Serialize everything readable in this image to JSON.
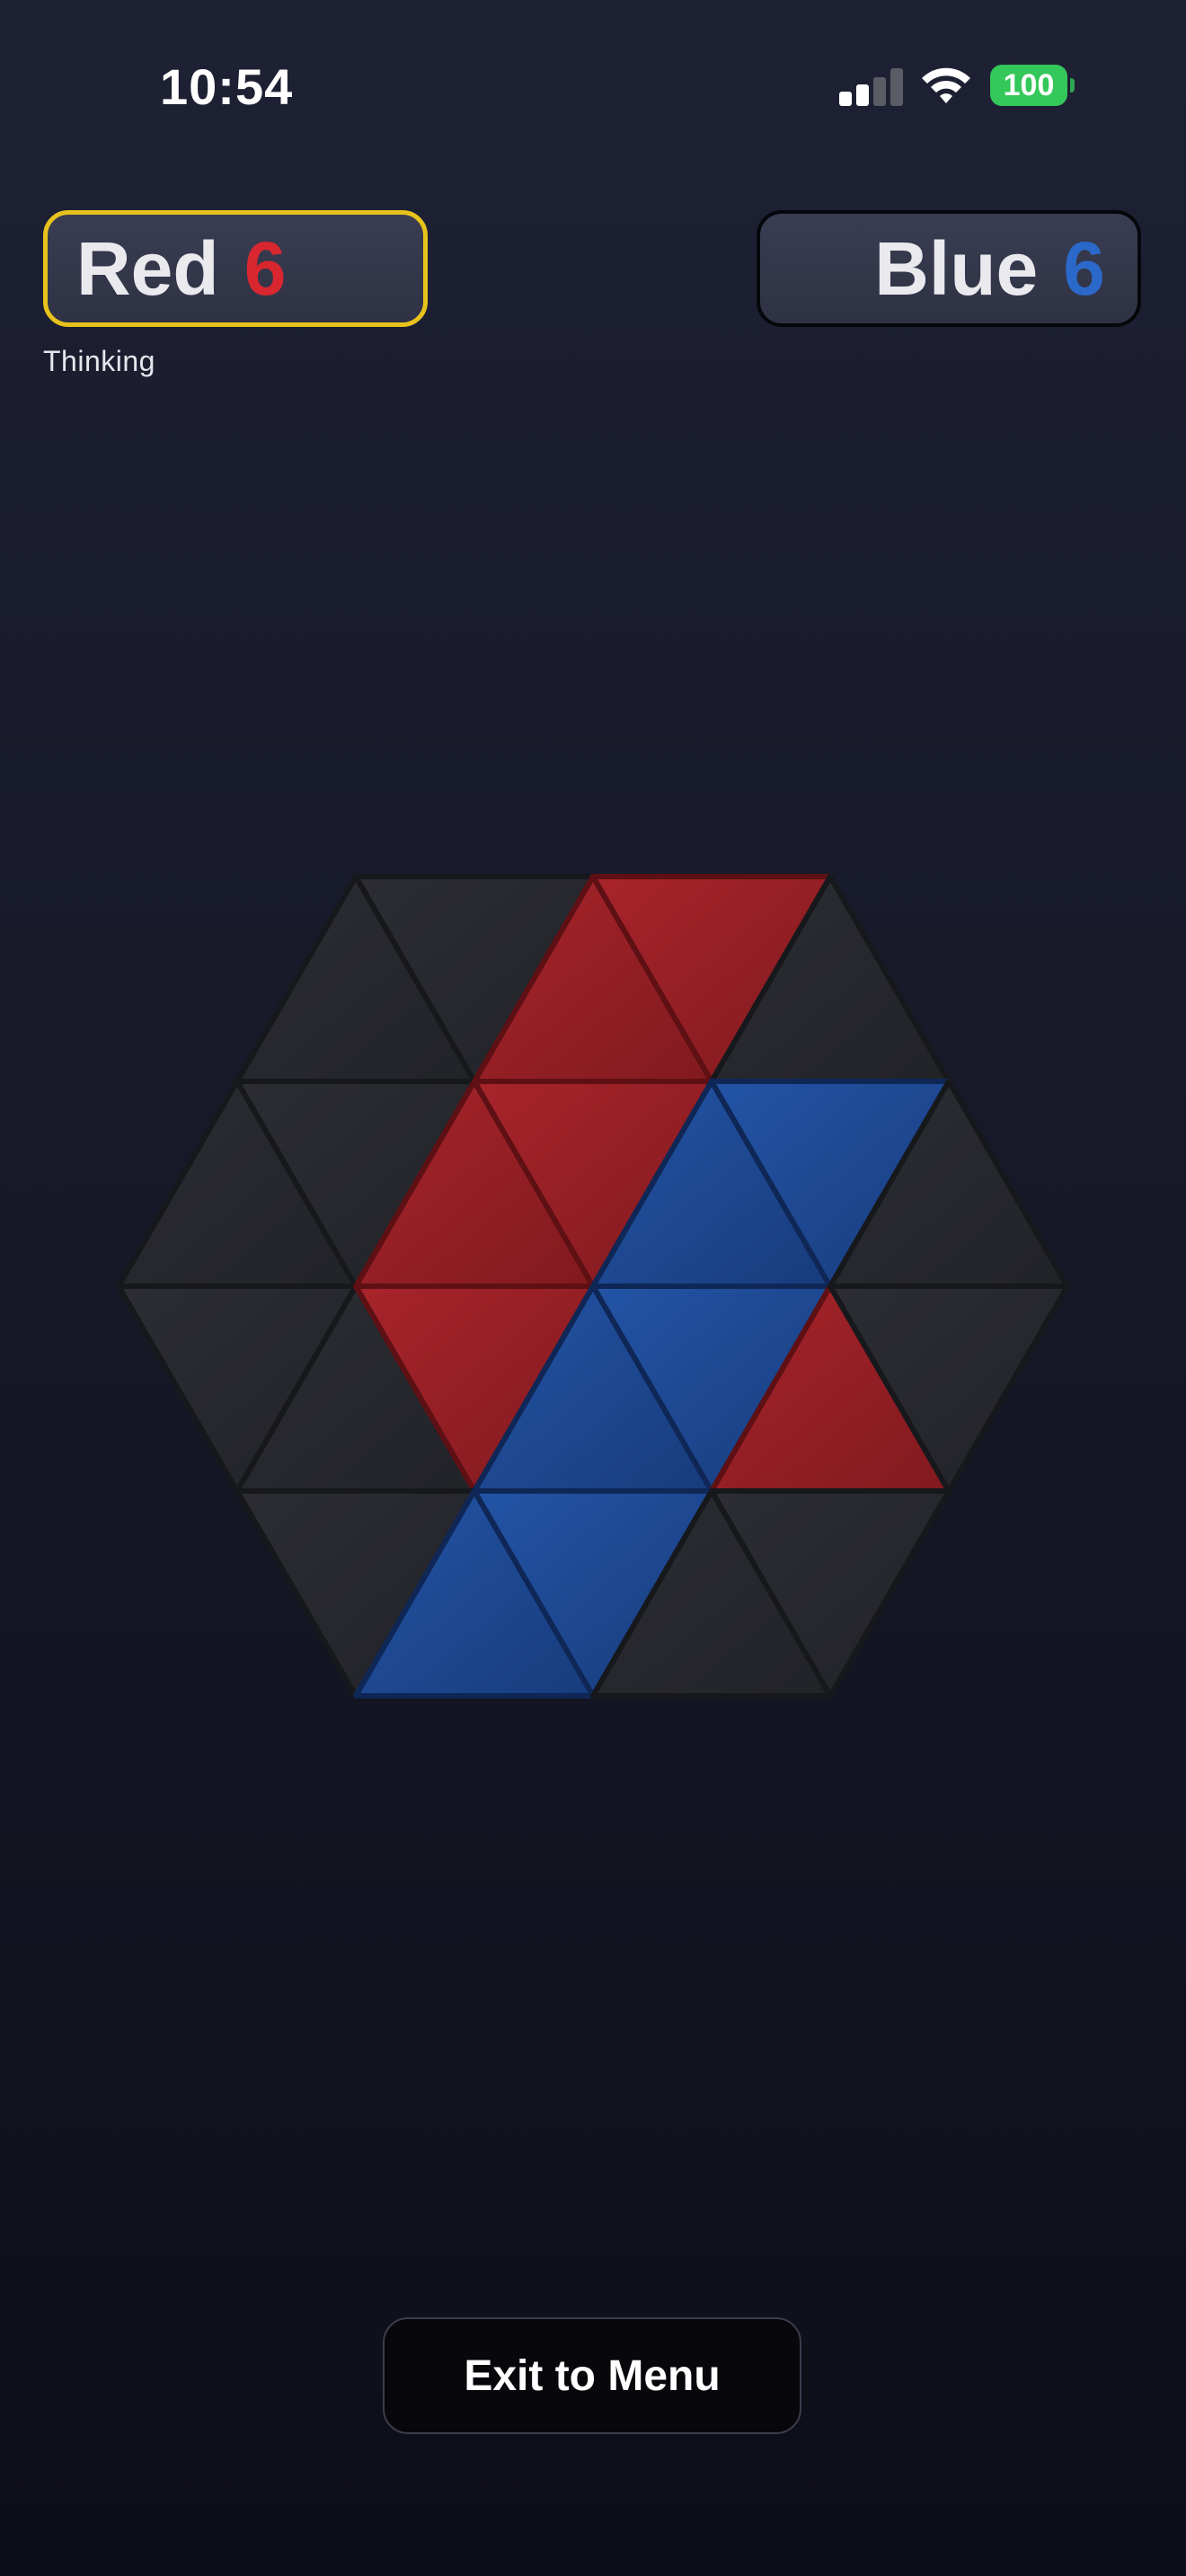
{
  "status_bar": {
    "time": "10:54",
    "battery": "100",
    "signal_icon": "cellular-signal-icon",
    "wifi_icon": "wifi-icon",
    "battery_color": "#34c759"
  },
  "players": {
    "red": {
      "name": "Red",
      "score": "6",
      "color": "#d8272f",
      "active": true,
      "status": "Thinking"
    },
    "blue": {
      "name": "Blue",
      "score": "6",
      "color": "#2a69c9",
      "active": false
    }
  },
  "board": {
    "shape": "hexagon",
    "rows": [
      [
        "empty",
        "empty",
        "red",
        "red",
        "empty"
      ],
      [
        "empty",
        "empty",
        "red",
        "red",
        "blue",
        "blue",
        "empty"
      ],
      [
        "empty",
        "empty",
        "red",
        "blue",
        "blue",
        "red",
        "empty"
      ],
      [
        "empty",
        "blue",
        "blue",
        "empty",
        "empty"
      ]
    ],
    "colors": {
      "empty": "#26272d",
      "red": "#8e1c22",
      "blue": "#1b4188",
      "active_border": "#e8c21c"
    }
  },
  "exit_button": {
    "label": "Exit to Menu"
  }
}
